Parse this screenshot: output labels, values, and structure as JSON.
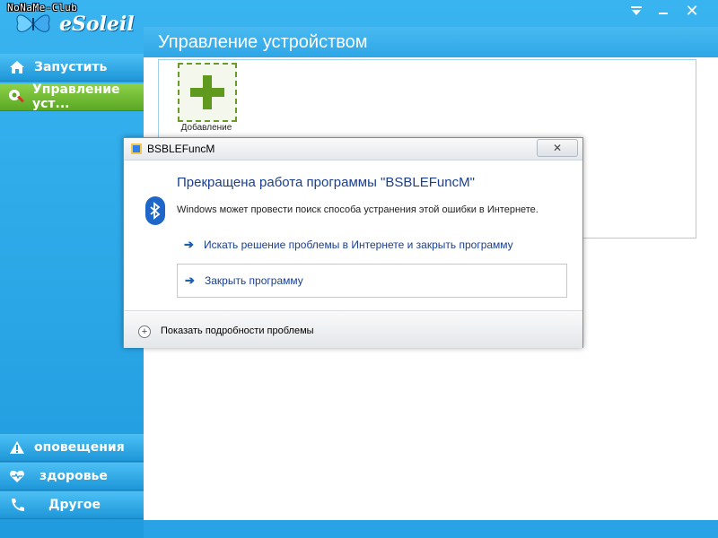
{
  "app": {
    "watermark": "NoNaMe-Club",
    "brand": "eSoleil",
    "close_glyph": "✕",
    "page_title": "Управление устройством",
    "add_tile_label": "Добавление",
    "accent": "#2aa3e6",
    "active_green": "#6db22e"
  },
  "sidebar": {
    "items": [
      {
        "label": "Запустить",
        "icon": "home-icon"
      },
      {
        "label": "Управление уст...",
        "icon": "tools-icon"
      },
      {
        "label": "оповещения",
        "icon": "warning-icon"
      },
      {
        "label": "здоровье",
        "icon": "heart-icon"
      },
      {
        "label": "Другое",
        "icon": "phone-icon"
      }
    ]
  },
  "dialog": {
    "title": "BSBLEFuncM",
    "close_glyph": "✕",
    "heading": "Прекращена работа программы \"BSBLEFuncM\"",
    "subtext": "Windows может провести поиск способа устранения этой ошибки в Интернете.",
    "option_online": "Искать решение проблемы в Интернете и закрыть программу",
    "option_close": "Закрыть программу",
    "details": "Показать подробности проблемы",
    "arrow_glyph": "➔",
    "plus_glyph": "+"
  }
}
